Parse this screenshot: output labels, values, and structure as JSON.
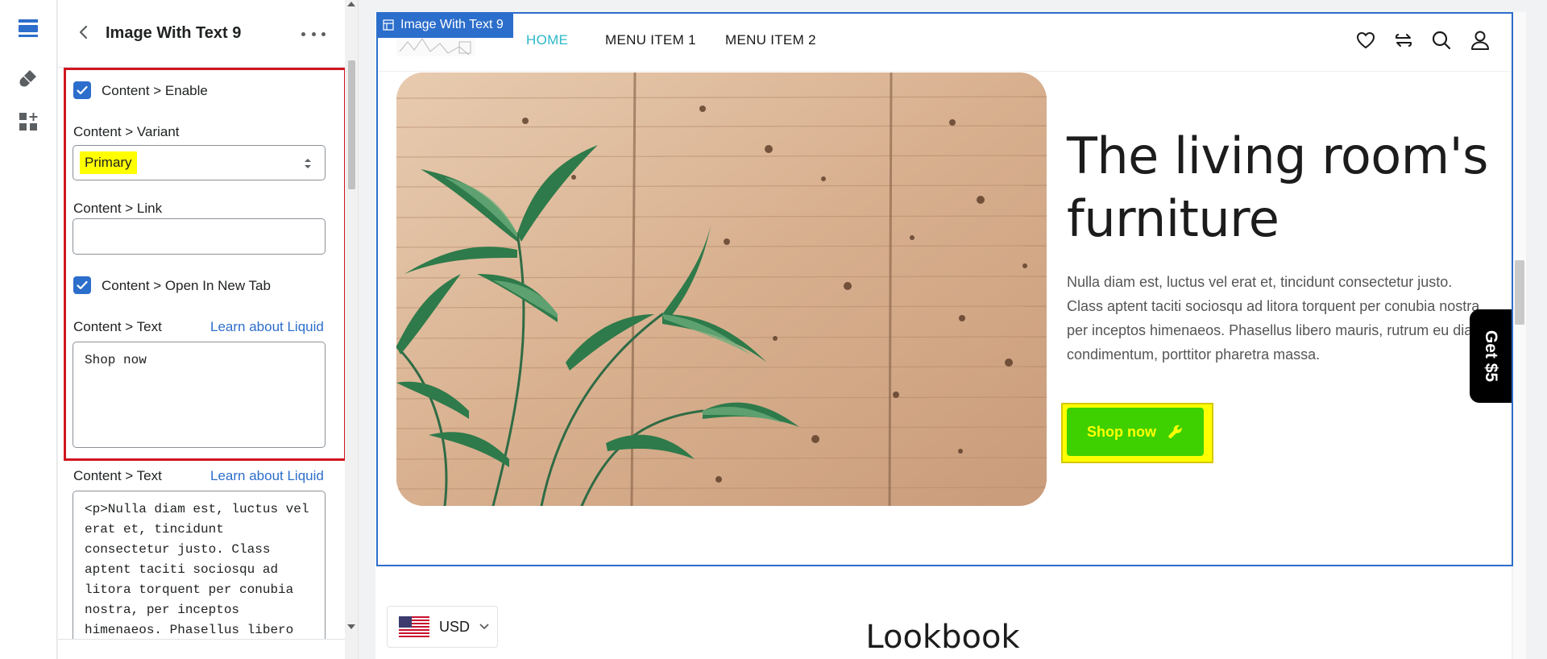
{
  "panel": {
    "title": "Image With Text 9",
    "fields": {
      "enable_label": "Content > Enable",
      "variant_label": "Content > Variant",
      "variant_value": "Primary",
      "link_label": "Content > Link",
      "link_value": "",
      "new_tab_label": "Content > Open In New Tab",
      "text_label": "Content > Text",
      "text_link": "Learn about Liquid",
      "text_value": "Shop now",
      "text2_label": "Content > Text",
      "text2_link": "Learn about Liquid",
      "text2_value": "<p>Nulla diam est, luctus vel\nerat et, tincidunt\nconsectetur justo. Class\naptent taciti sociosqu ad\nlitora torquent per conubia\nnostra, per inceptos\nhimenaeos. Phasellus libero"
    }
  },
  "preview": {
    "section_tag": "Image With Text 9",
    "nav": [
      "HOME",
      "MENU ITEM 1",
      "MENU ITEM 2"
    ],
    "heading": "The living room's furniture",
    "paragraph": "Nulla diam est, luctus vel erat et, tincidunt consectetur justo. Class aptent taciti sociosqu ad litora torquent per conubia nostra, per inceptos himenaeos. Phasellus libero mauris, rutrum eu diam condimentum, porttitor pharetra massa.",
    "button_label": "Shop now",
    "promo_tab": "Get $5",
    "currency": "USD",
    "next_section_title": "Lookbook"
  },
  "colors": {
    "accent": "#2c6ecb",
    "nav_active": "#2bb8c8",
    "button_bg": "#3fd000",
    "button_text": "#ffff00",
    "highlight": "#ffff00",
    "annotation_red": "#d0151f"
  },
  "icons": [
    "sections-icon",
    "theme-brush-icon",
    "add-app-block-icon",
    "back-arrow-icon",
    "more-dots-icon",
    "check-icon",
    "select-arrows-icon",
    "block-grid-icon",
    "heart-icon",
    "compare-icon",
    "search-icon",
    "account-icon",
    "wrench-icon",
    "us-flag-icon",
    "chevron-down-icon"
  ]
}
